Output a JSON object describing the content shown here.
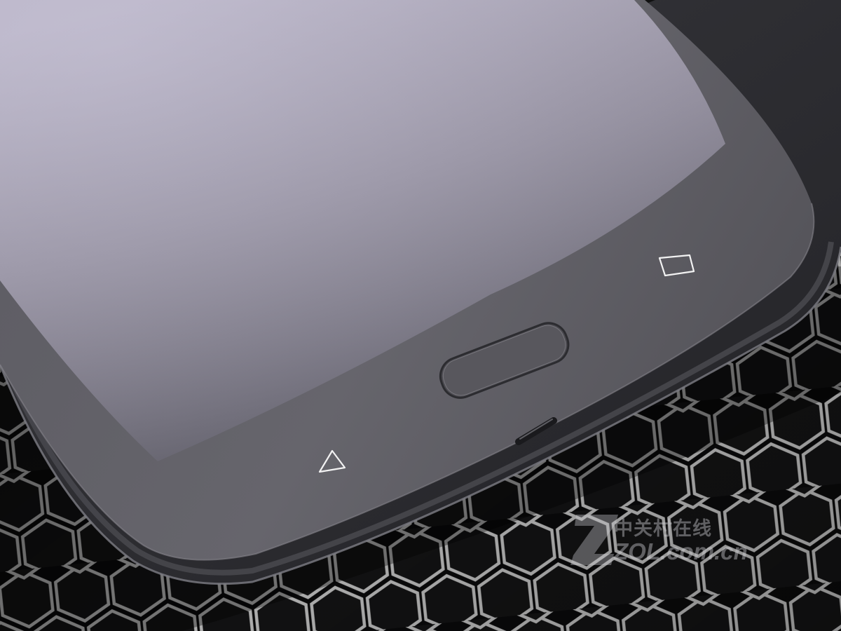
{
  "photo": {
    "subject": "smartphone-bottom-corner",
    "background_pattern": "hexagon-grid"
  },
  "watermark": {
    "logo_letter": "Z",
    "chinese_text": "中关村在线",
    "url_text": "ZOL.com.cn"
  },
  "colors": {
    "background": "#0b0b0c",
    "hex_cell": "#151516",
    "hex_edge": "#d8d8d8",
    "phone_frame": "#2b2b2f",
    "screen_top": "#b3aec0",
    "screen_bottom": "#6a6874",
    "bezel": "#5a5960",
    "key_outline": "#f2f2f2"
  },
  "icons": {
    "back": "back-triangle-icon",
    "recents": "recents-square-icon",
    "home": "fingerprint-home-button"
  }
}
